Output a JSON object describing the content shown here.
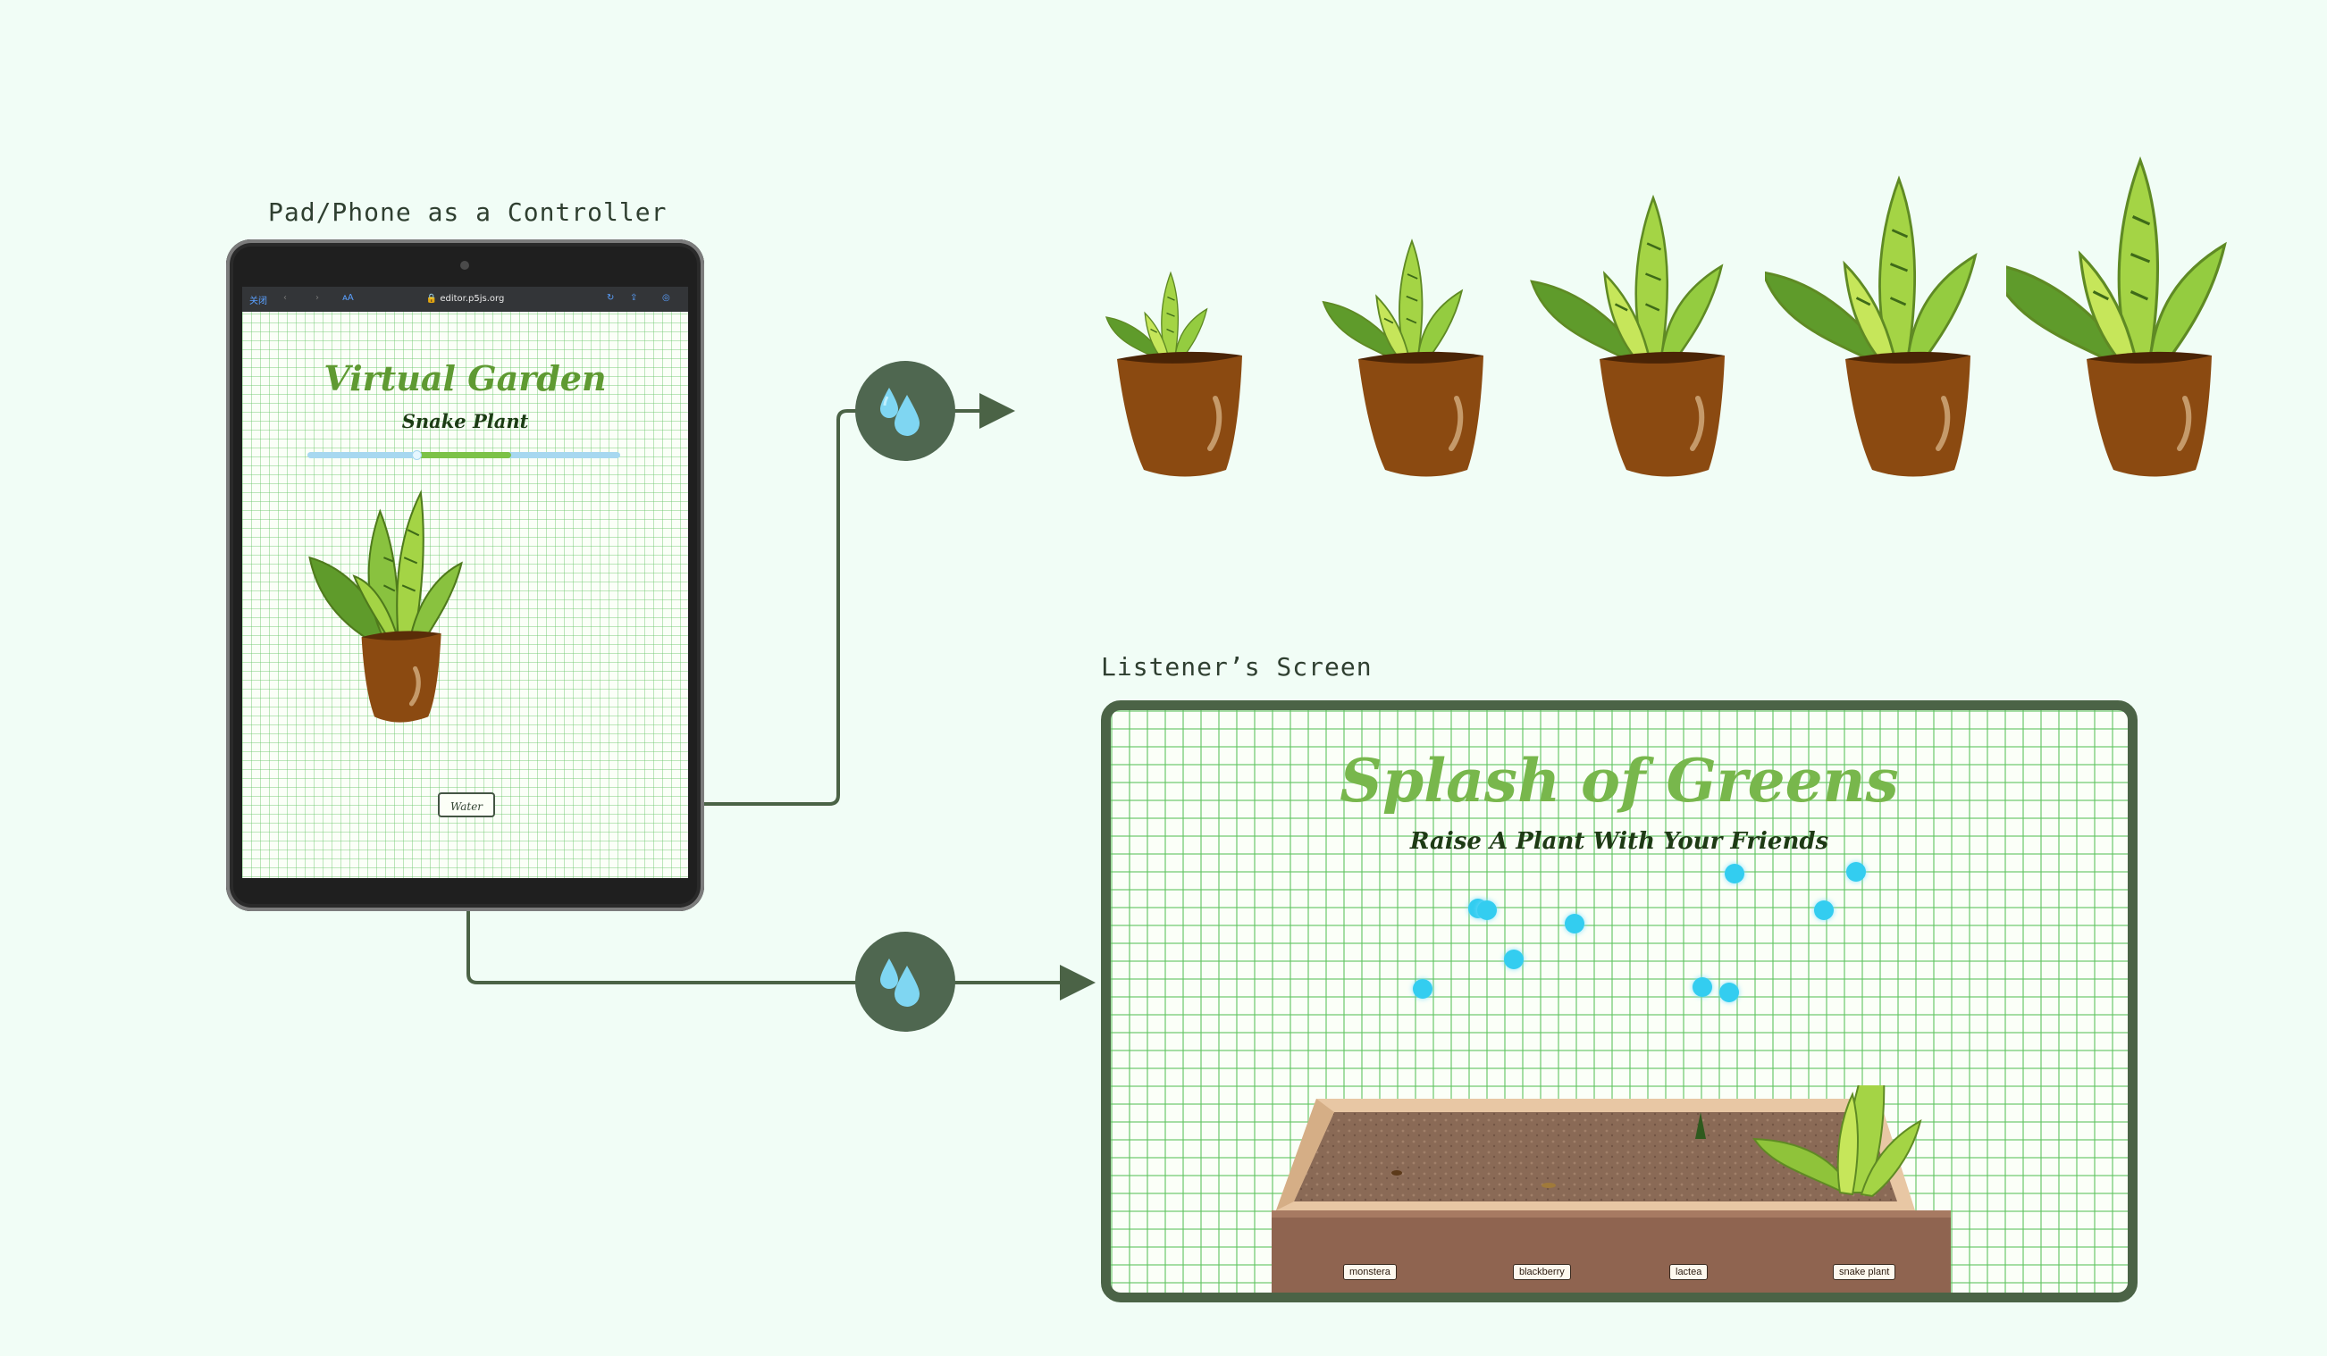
{
  "captions": {
    "controller": "Pad/Phone as a Controller",
    "listener": "Listener’s Screen"
  },
  "tablet": {
    "browser": {
      "left_button": "关闭",
      "text_size_button": "ᴀA",
      "url": "🔒 editor.p5js.org"
    },
    "app": {
      "title": "Virtual Garden",
      "subtitle": "Snake Plant",
      "growth_progress_start": 0.35,
      "growth_progress_end": 0.65,
      "water_button": "Water"
    }
  },
  "growth_stages_count": 5,
  "listener": {
    "title": "Splash of Greens",
    "subtitle": "Raise A Plant With Your Friends",
    "planter_labels": [
      "monstera",
      "blackberry",
      "lactea",
      "snake plant"
    ]
  },
  "colors": {
    "background": "#f1fdf6",
    "accent_dark_green": "#4b6346",
    "leaf_green": "#7cc247",
    "pot_brown": "#8b4a11",
    "water_blue": "#33cdf0"
  },
  "icons": [
    "water-drops-icon",
    "arrow-right-icon",
    "snake-plant-icon"
  ]
}
